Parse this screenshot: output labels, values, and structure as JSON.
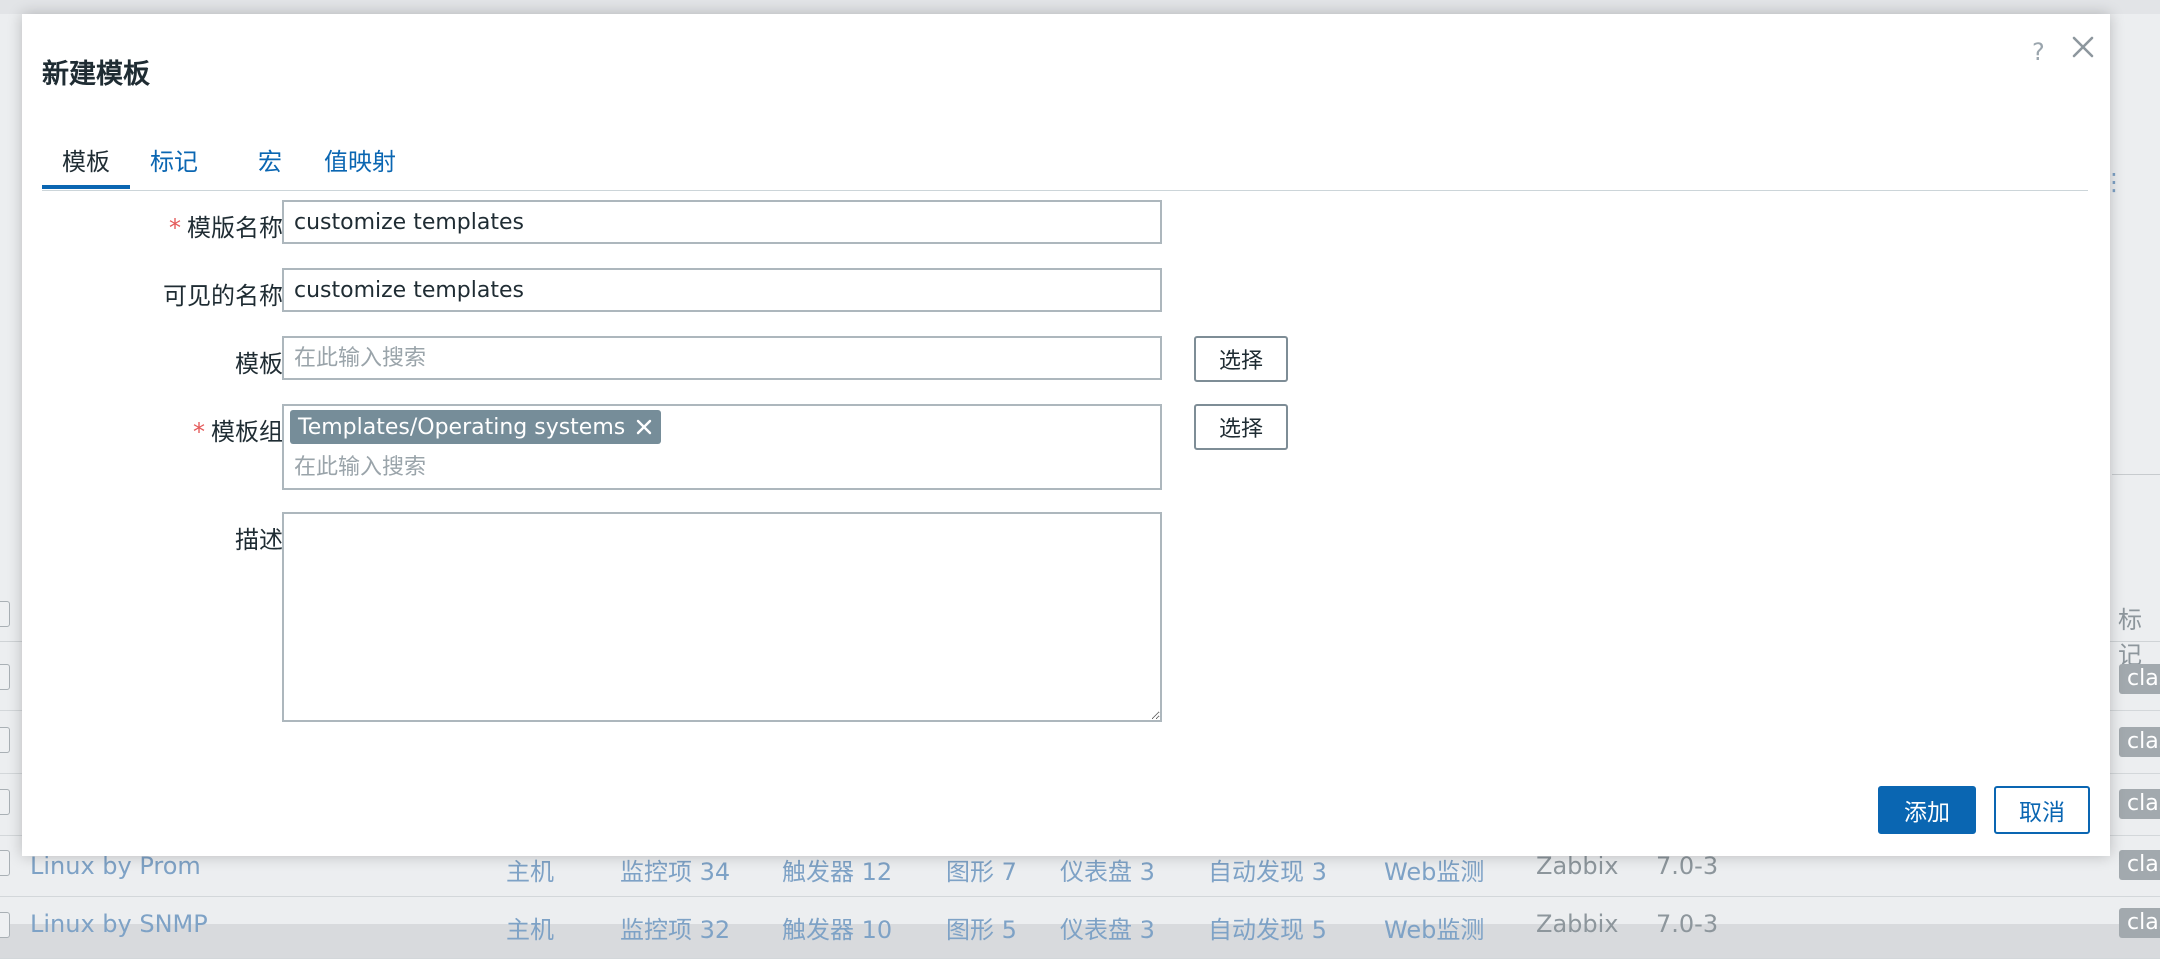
{
  "modal": {
    "title": "新建模板",
    "help": "?",
    "tabs": [
      {
        "label": "模板"
      },
      {
        "label": "标记"
      },
      {
        "label": "宏"
      },
      {
        "label": "值映射"
      }
    ],
    "fields": {
      "template_name": {
        "label": "模版名称",
        "value": "customize templates",
        "required": true
      },
      "visible_name": {
        "label": "可见的名称",
        "value": "customize templates"
      },
      "templates": {
        "label": "模板",
        "placeholder": "在此输入搜索",
        "button": "选择"
      },
      "template_groups": {
        "label": "模板组",
        "chip": "Templates/Operating systems",
        "placeholder": "在此输入搜索",
        "button": "选择",
        "required": true
      },
      "description": {
        "label": "描述",
        "value": ""
      }
    },
    "buttons": {
      "add": "添加",
      "cancel": "取消"
    }
  },
  "background": {
    "column_header_partial": "标记",
    "tag_partial": "clas",
    "rows": [
      {
        "name": "Linux by Prom",
        "hosts": "主机",
        "items": "监控项 34",
        "triggers": "触发器 12",
        "graphs": "图形 7",
        "dashboards": "仪表盘 3",
        "discovery": "自动发现 3",
        "web": "Web监测",
        "vendor": "Zabbix",
        "version": "7.0-3"
      },
      {
        "name": "Linux by SNMP",
        "hosts": "主机",
        "items": "监控项 32",
        "triggers": "触发器 10",
        "graphs": "图形 5",
        "dashboards": "仪表盘 3",
        "discovery": "自动发现 5",
        "web": "Web监测",
        "vendor": "Zabbix",
        "version": "7.0-3"
      }
    ]
  },
  "colors": {
    "accent": "#0a66b2",
    "chip": "#768d99",
    "required": "#e45959"
  }
}
